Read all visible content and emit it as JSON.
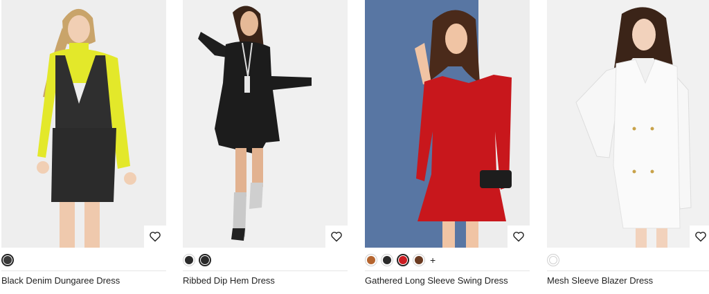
{
  "products": [
    {
      "name": "Black Denim Dungaree Dress",
      "swatches": [
        {
          "color": "#3a3a3a",
          "selected": true
        }
      ],
      "more": ""
    },
    {
      "name": "Ribbed Dip Hem Dress",
      "swatches": [
        {
          "color": "#2a2a2a",
          "selected": false
        },
        {
          "color": "#2a2a2a",
          "selected": true
        }
      ],
      "more": ""
    },
    {
      "name": "Gathered Long Sleeve Swing Dress",
      "swatches": [
        {
          "color": "#b5652f",
          "selected": false
        },
        {
          "color": "#2a2a2a",
          "selected": false
        },
        {
          "color": "#cc1c22",
          "selected": true
        },
        {
          "color": "#6b3b22",
          "selected": false
        }
      ],
      "more": "+"
    },
    {
      "name": "Mesh Sleeve Blazer Dress",
      "swatches": [
        {
          "color": "#ffffff",
          "selected": false
        }
      ],
      "more": ""
    }
  ]
}
